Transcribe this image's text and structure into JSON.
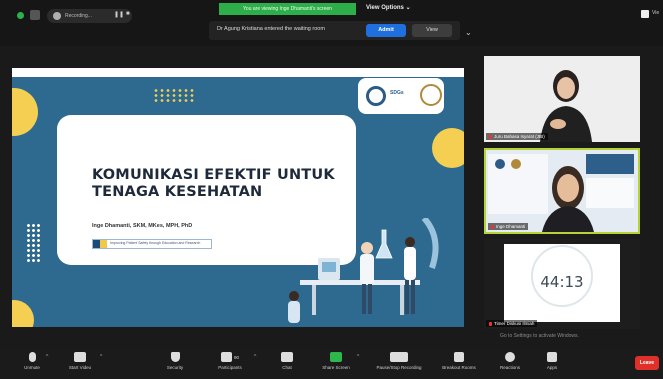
{
  "topbar": {
    "recording_label": "Recording...",
    "green_banner": "You are viewing Inge Dhamanti's screen",
    "view_options_label": "View Options",
    "waiting_room": {
      "message": "Dr Agung Kristiana entered the waiting room",
      "admit_label": "Admit",
      "view_label": "View"
    },
    "top_right_label": "Vie"
  },
  "slide": {
    "title_line1": "KOMUNIKASI EFEKTIF UNTUK",
    "title_line2": "TENAGA KESEHATAN",
    "author": "Inge Dhamanti, SKM, MKes, MPH, PhD",
    "tagline": "Improving Patient Safety through Education and Research",
    "logo_text": "SDGs",
    "colors": {
      "background": "#2e6a8f",
      "accent_yellow": "#f4cf52",
      "card": "#ffffff"
    }
  },
  "participants": [
    {
      "name": "Juru Bahasa Isyarat (JBI)"
    },
    {
      "name": "Inge Dhamanti"
    },
    {
      "name": "Timer Diskusi Ilmiah",
      "timer": "44:13"
    }
  ],
  "activate_windows": "Go to Settings to activate Windows.",
  "toolbar": {
    "items": [
      {
        "label": "Unmute",
        "icon": "microphone-icon"
      },
      {
        "label": "Start Video",
        "icon": "video-icon"
      },
      {
        "label": "Security",
        "icon": "shield-icon"
      },
      {
        "label": "Participants",
        "icon": "participants-icon",
        "count": "90"
      },
      {
        "label": "Chat",
        "icon": "chat-icon"
      },
      {
        "label": "Share Screen",
        "icon": "share-screen-icon"
      },
      {
        "label": "Pause/Stop Recording",
        "icon": "recording-icon"
      },
      {
        "label": "Breakout Rooms",
        "icon": "breakout-rooms-icon"
      },
      {
        "label": "Reactions",
        "icon": "reactions-icon"
      },
      {
        "label": "Apps",
        "icon": "apps-icon"
      }
    ],
    "leave_label": "Leave"
  }
}
